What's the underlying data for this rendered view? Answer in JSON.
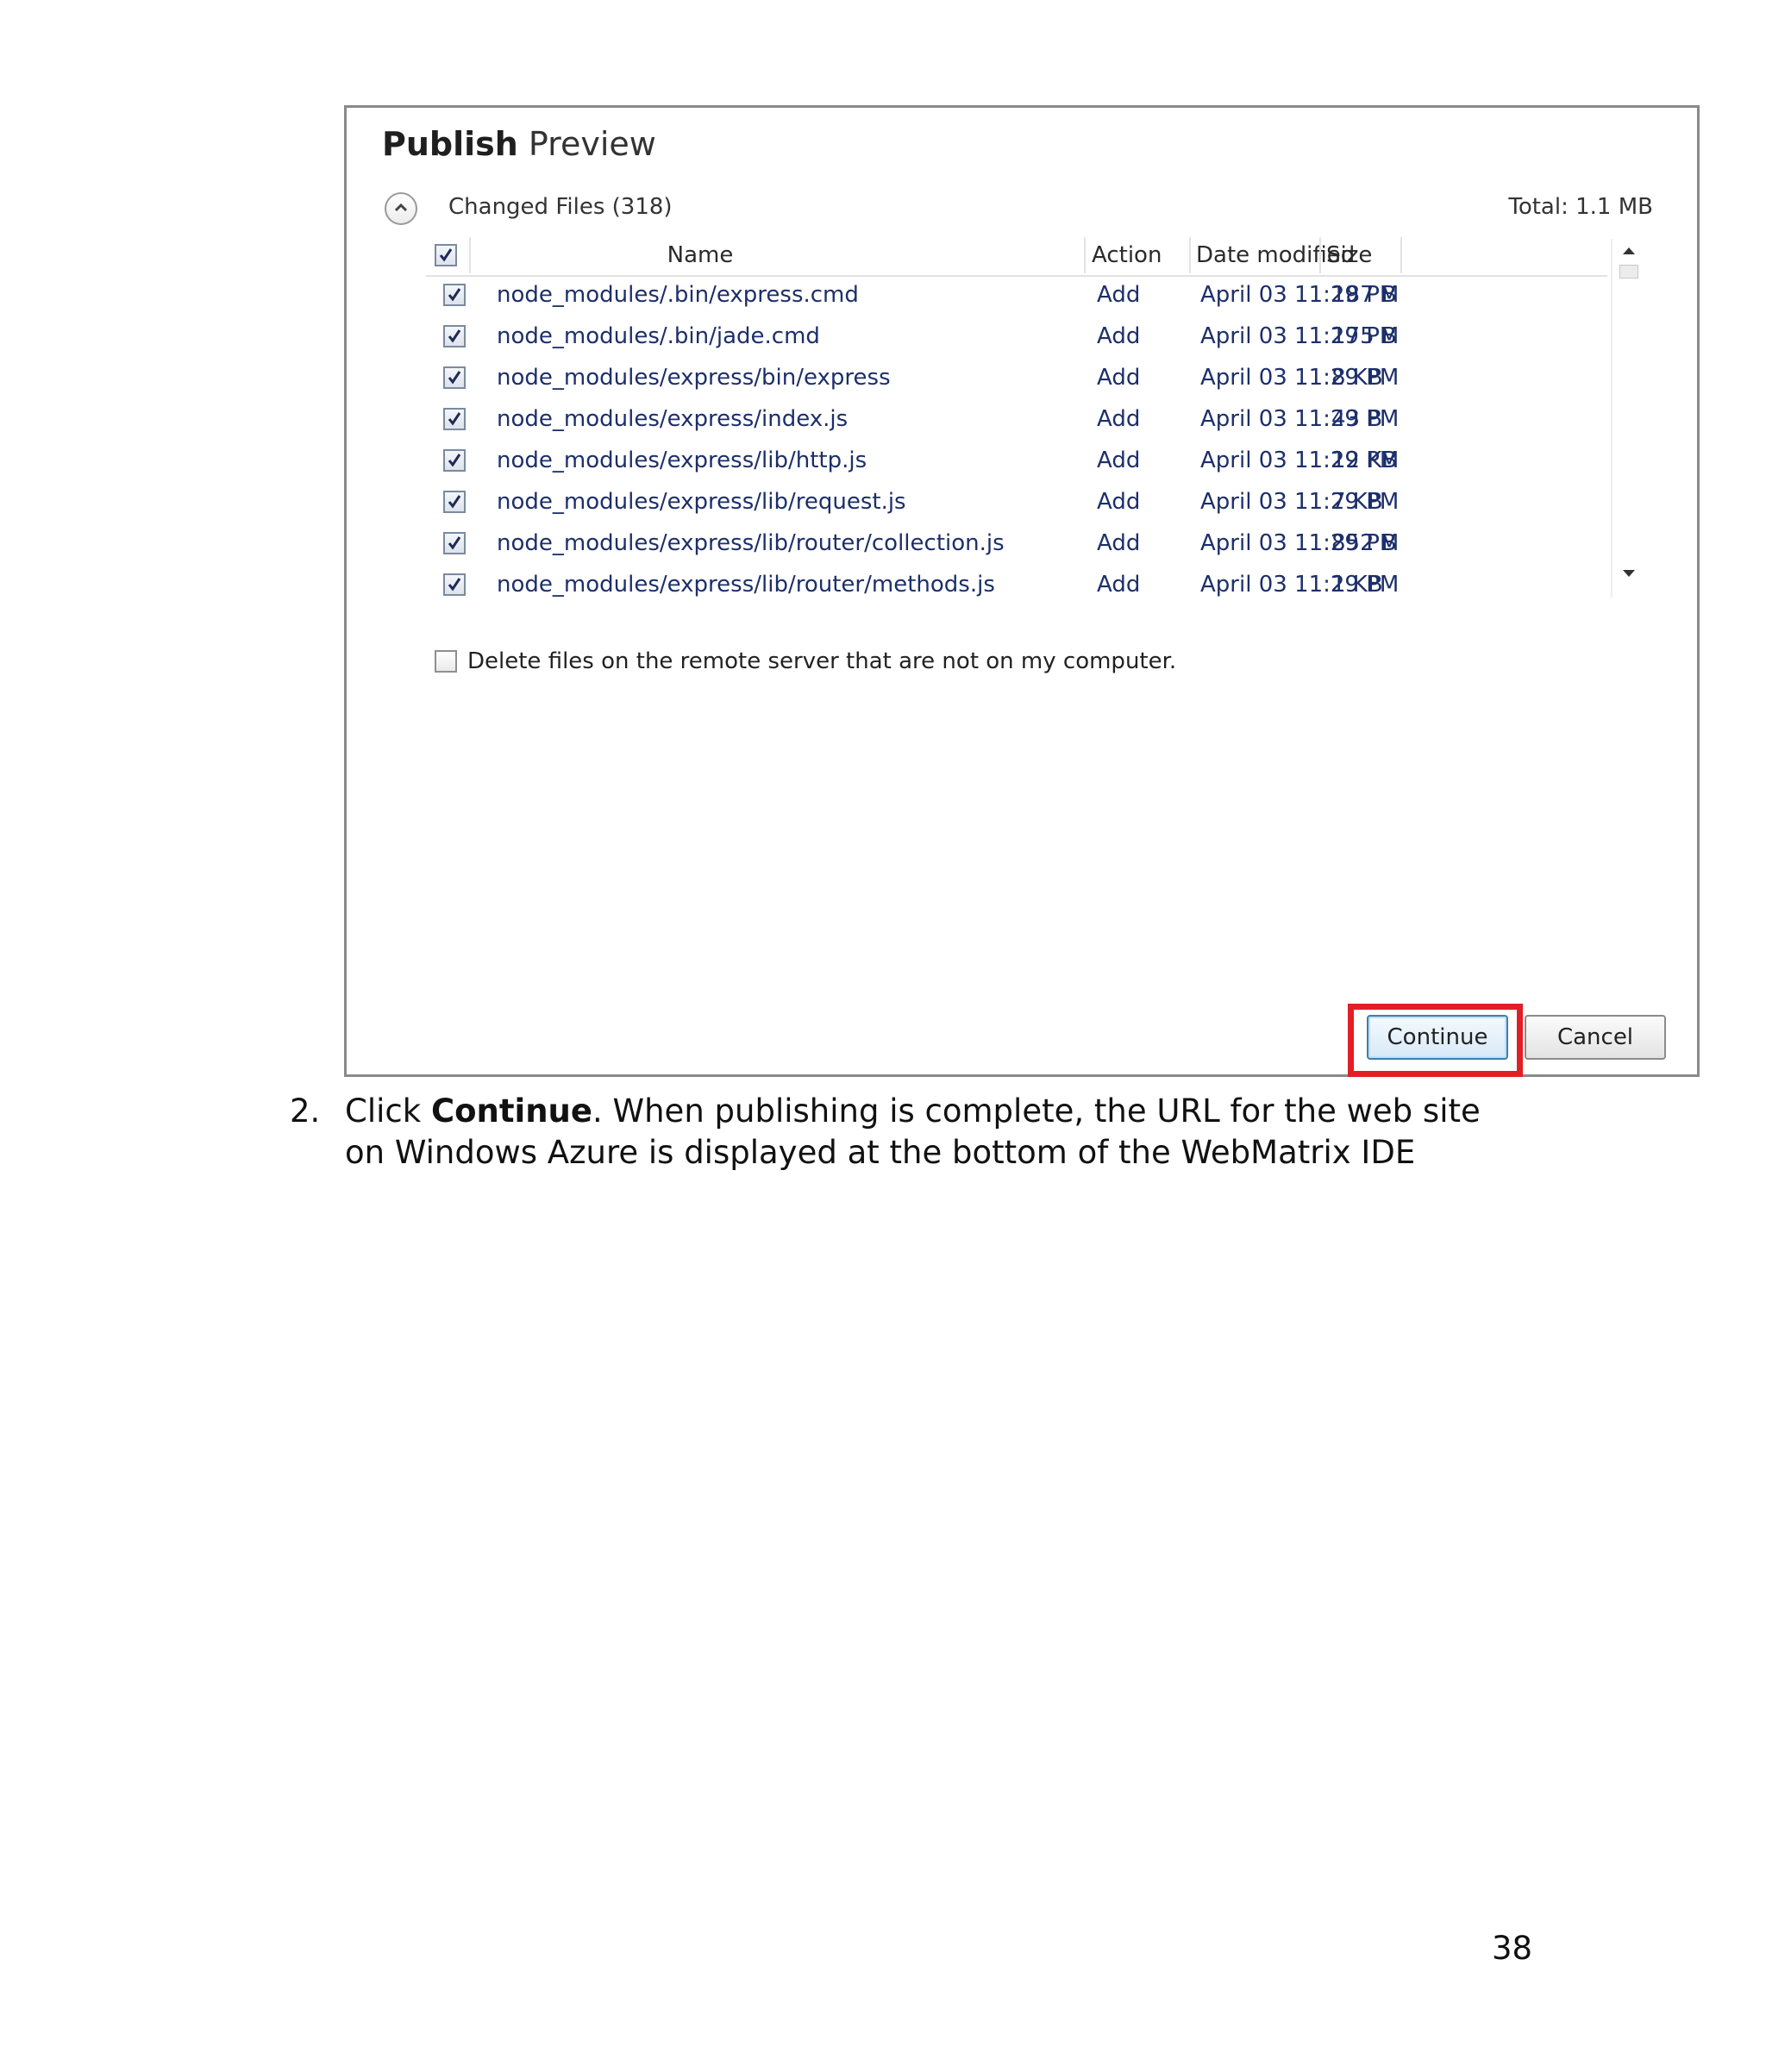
{
  "dialog": {
    "title_bold": "Publish",
    "title_light": "Preview",
    "section_label": "Changed Files (318)",
    "total_label": "Total: 1.1 MB",
    "columns": {
      "name": "Name",
      "action": "Action",
      "date": "Date modified",
      "size": "Size"
    },
    "files": [
      {
        "name": "node_modules/.bin/express.cmd",
        "action": "Add",
        "date": "April 03 11:29 PM",
        "size": "187 B",
        "checked": true
      },
      {
        "name": "node_modules/.bin/jade.cmd",
        "action": "Add",
        "date": "April 03 11:29 PM",
        "size": "175 B",
        "checked": true
      },
      {
        "name": "node_modules/express/bin/express",
        "action": "Add",
        "date": "April 03 11:29 PM",
        "size": "8 KB",
        "checked": true
      },
      {
        "name": "node_modules/express/index.js",
        "action": "Add",
        "date": "April 03 11:29 PM",
        "size": "43 B",
        "checked": true
      },
      {
        "name": "node_modules/express/lib/http.js",
        "action": "Add",
        "date": "April 03 11:29 PM",
        "size": "12 KB",
        "checked": true
      },
      {
        "name": "node_modules/express/lib/request.js",
        "action": "Add",
        "date": "April 03 11:29 PM",
        "size": "7 KB",
        "checked": true
      },
      {
        "name": "node_modules/express/lib/router/collection.js",
        "action": "Add",
        "date": "April 03 11:29 PM",
        "size": "852 B",
        "checked": true
      },
      {
        "name": "node_modules/express/lib/router/methods.js",
        "action": "Add",
        "date": "April 03 11:29 PM",
        "size": "1 KB",
        "checked": true
      }
    ],
    "delete_option": "Delete files on the remote server that are not on my computer.",
    "continue_label": "Continue",
    "cancel_label": "Cancel",
    "highlight_color": "#e21e26"
  },
  "doc": {
    "step_number": "2.",
    "step_intro": "Click ",
    "step_bold": "Continue",
    "step_rest": ". When publishing is complete, the URL for the web site on Windows Azure is displayed at the bottom of the WebMatrix IDE",
    "page_number": "38"
  }
}
